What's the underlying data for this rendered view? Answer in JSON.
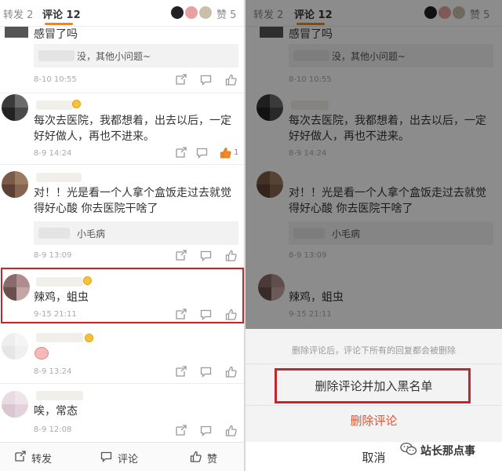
{
  "tabs": {
    "repost": "转发 2",
    "comments": "评论 12",
    "likes": "赞 5"
  },
  "comments": [
    {
      "text": "感冒了吗",
      "reply": "没，其他小问题~",
      "time": "8-10 10:55",
      "likes": ""
    },
    {
      "text": "每次去医院，我都想着，出去以后，一定好好做人，再也不进来。",
      "reply": "",
      "time": "8-9 14:24",
      "likes": "1"
    },
    {
      "text": "对！！光是看一个人拿个盒饭走过去就觉得好心酸 你去医院干啥了",
      "reply": "小毛病",
      "time": "8-9 13:09",
      "likes": ""
    },
    {
      "text": "辣鸡，蛆虫",
      "reply": "",
      "time": "9-15 21:11",
      "likes": ""
    },
    {
      "text": "",
      "reply": "",
      "time": "8-9 13:24",
      "likes": ""
    },
    {
      "text": "唉，常态",
      "reply": "",
      "time": "8-9 12:08",
      "likes": ""
    }
  ],
  "bottom_bar": {
    "repost": "转发",
    "comment": "评论",
    "like": "赞"
  },
  "sheet": {
    "hint": "删除评论后，评论下所有的回复都会被删除",
    "block_delete": "删除评论并加入黑名单",
    "delete": "删除评论",
    "cancel": "取消"
  },
  "watermark": "站长那点事",
  "colors": {
    "accent": "#ff8200",
    "highlight": "#c1272d",
    "delete_red": "#e8502a"
  },
  "icons": [
    "repost-icon",
    "comment-icon",
    "like-icon",
    "emoji-icon",
    "wechat-icon"
  ]
}
